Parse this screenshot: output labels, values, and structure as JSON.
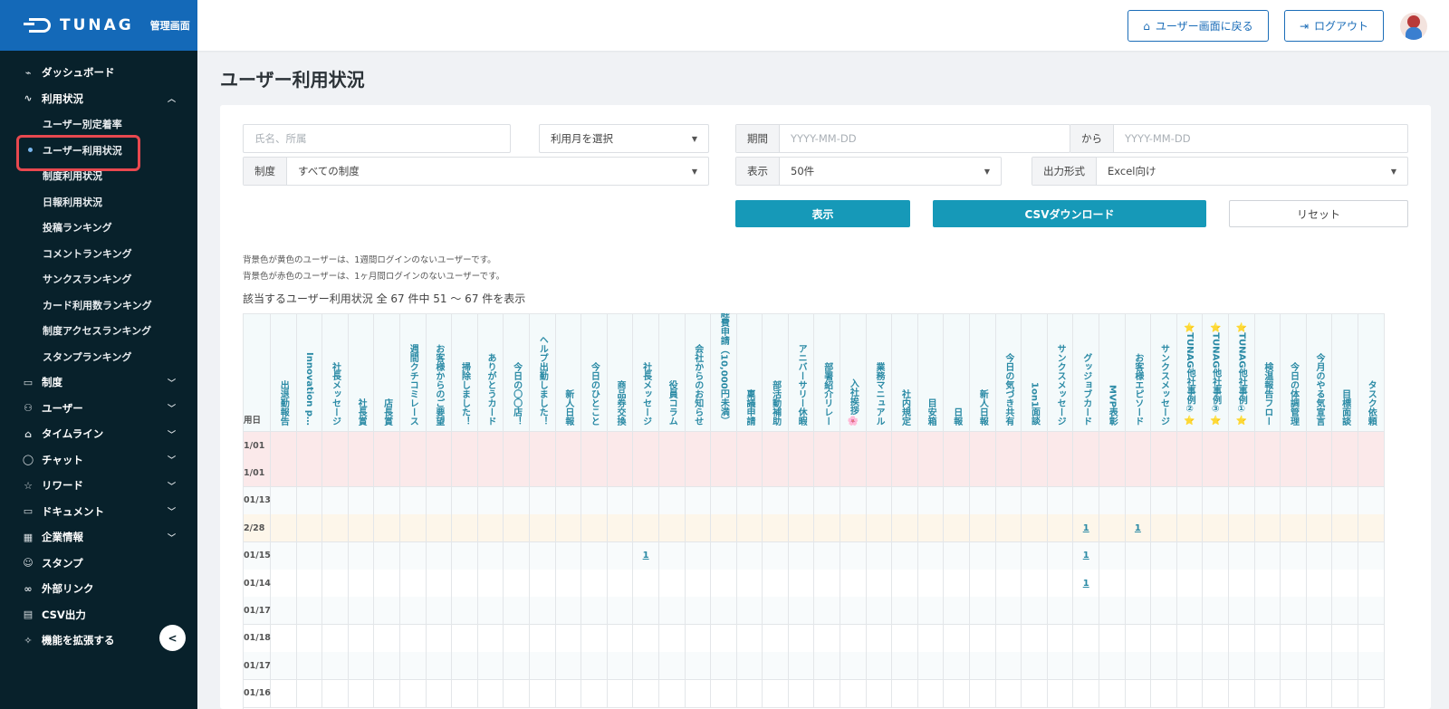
{
  "brand": {
    "logo_text": "TUNAG",
    "admin_label": "管理画面"
  },
  "sidebar": {
    "items": [
      {
        "label": "ダッシュボード",
        "icon": "chart-line-icon",
        "glyph": "⌁",
        "chev": ""
      },
      {
        "label": "利用状況",
        "icon": "pulse-icon",
        "glyph": "∿",
        "chev": "^"
      },
      {
        "label": "制度",
        "icon": "book-icon",
        "glyph": "▭",
        "chev": "v"
      },
      {
        "label": "ユーザー",
        "icon": "users-icon",
        "glyph": "⚇",
        "chev": "v"
      },
      {
        "label": "タイムライン",
        "icon": "home-icon",
        "glyph": "⌂",
        "chev": "v"
      },
      {
        "label": "チャット",
        "icon": "chat-icon",
        "glyph": "◯",
        "chev": "v"
      },
      {
        "label": "リワード",
        "icon": "star-icon",
        "glyph": "☆",
        "chev": "v"
      },
      {
        "label": "ドキュメント",
        "icon": "folder-icon",
        "glyph": "▭",
        "chev": "v"
      },
      {
        "label": "企業情報",
        "icon": "building-icon",
        "glyph": "▦",
        "chev": "v"
      },
      {
        "label": "スタンプ",
        "icon": "smile-icon",
        "glyph": "☺",
        "chev": ""
      },
      {
        "label": "外部リンク",
        "icon": "link-icon",
        "glyph": "∞",
        "chev": ""
      },
      {
        "label": "CSV出力",
        "icon": "table-icon",
        "glyph": "▤",
        "chev": ""
      },
      {
        "label": "機能を拡張する",
        "icon": "sparkle-icon",
        "glyph": "✧",
        "chev": ""
      }
    ],
    "sub_items": [
      "ユーザー別定着率",
      "ユーザー利用状況",
      "制度利用状況",
      "日報利用状況",
      "投稿ランキング",
      "コメントランキング",
      "サンクスランキング",
      "カード利用数ランキング",
      "制度アクセスランキング",
      "スタンプランキング"
    ],
    "collapse_glyph": "<"
  },
  "header": {
    "back_button": "ユーザー画面に戻る",
    "logout_button": "ログアウト"
  },
  "page_title": "ユーザー利用状況",
  "filters": {
    "name_placeholder": "氏名、所属",
    "month_placeholder": "利用月を選択",
    "period_label": "期間",
    "date_placeholder": "YYYY-MM-DD",
    "from_label": "から",
    "system_label": "制度",
    "system_value": "すべての制度",
    "display_label": "表示",
    "display_value": "50件",
    "format_label": "出力形式",
    "format_value": "Excel向け"
  },
  "actions": {
    "show": "表示",
    "csv": "CSVダウンロード",
    "reset": "リセット"
  },
  "notes": [
    "背景色が黄色のユーザーは、1週間ログインのないユーザーです。",
    "背景色が赤色のユーザーは、1ヶ月間ログインのないユーザーです。"
  ],
  "result_text": "該当するユーザー利用状況 全 67 件中 51 〜 67 件を表示",
  "table": {
    "date_header": "用日",
    "columns": [
      "出退勤報告",
      "Innovation p…",
      "社長メッセージ",
      "社長賞",
      "店長賞",
      "週間クチコミレース",
      "お客様からのご要望",
      "掃除しました！",
      "ありがとうカード",
      "今日の〇〇店！",
      "ヘルプ出勤しました！",
      "新人日報",
      "今日のひとこと",
      "商品券交換",
      "社長メッセージ",
      "役員コラム",
      "会社からのお知らせ",
      "経費申請（10,000円未満）",
      "稟議申請",
      "部活動補助",
      "アニバーサリー休暇",
      "部署紹介リレー",
      "入社挨拶🌸",
      "業務マニュアル",
      "社内規定",
      "目安箱",
      "日報",
      "新人日報",
      "今日の気づき共有",
      "1on1面談",
      "サンクスメッセージ",
      "グッジョブカード",
      "MVP表彰",
      "お客様エピソード",
      "サンクスメッセージ",
      "⭐TUNAG他社事例②⭐",
      "⭐TUNAG他社事例③⭐",
      "⭐TUNAG他社事例①⭐",
      "検温報告フロー",
      "今日の体調管理",
      "今月のやる気宣言",
      "目標面談",
      "タスク依頼"
    ],
    "rows": [
      {
        "date": "1/01",
        "bg": "#fbe9ea",
        "cells": []
      },
      {
        "date": "1/01",
        "bg": "#fbe9ea",
        "cells": []
      },
      {
        "date": "01/13",
        "bg": "#f8fbfc",
        "cells": []
      },
      {
        "date": "2/28",
        "bg": "#fdf6ea",
        "cells": [
          {
            "col": 31,
            "val": "1"
          },
          {
            "col": 33,
            "val": "1"
          }
        ]
      },
      {
        "date": "01/15",
        "bg": "#f8fbfc",
        "cells": [
          {
            "col": 14,
            "val": "1"
          },
          {
            "col": 31,
            "val": "1"
          }
        ]
      },
      {
        "date": "01/14",
        "bg": "#ffffff",
        "cells": [
          {
            "col": 31,
            "val": "1"
          }
        ]
      },
      {
        "date": "01/17",
        "bg": "#f8fbfc",
        "cells": []
      },
      {
        "date": "01/18",
        "bg": "#ffffff",
        "cells": []
      },
      {
        "date": "01/17",
        "bg": "#f8fbfc",
        "cells": []
      },
      {
        "date": "01/16",
        "bg": "#ffffff",
        "cells": []
      }
    ]
  },
  "colors": {
    "sidebar": "#08212b",
    "brand": "#1469b8",
    "primary": "#1699b8",
    "highlight": "#e8484f"
  }
}
